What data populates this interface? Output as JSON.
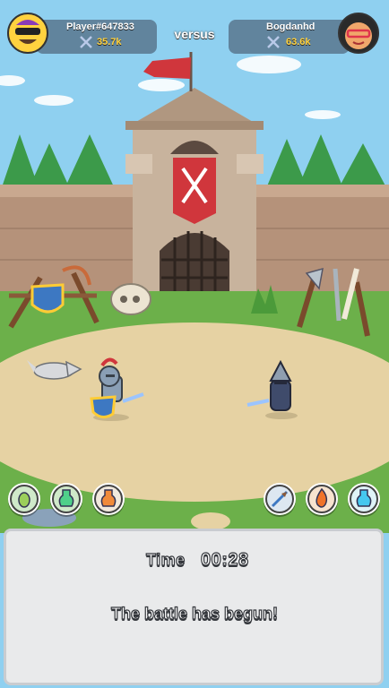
{
  "player_left": {
    "name": "Player#647833",
    "score": "35.7k",
    "avatar_icon": "sunglasses-face-avatar"
  },
  "player_right": {
    "name": "Bogdanhd",
    "score": "63.6k",
    "avatar_icon": "red-glasses-face-avatar"
  },
  "versus_label": "versus",
  "abilities_left": [
    "seed-ability-icon",
    "green-potion-icon",
    "orange-potion-icon"
  ],
  "abilities_right": [
    "arrow-ability-icon",
    "fire-ability-icon",
    "blue-potion-icon"
  ],
  "panel": {
    "time_label": "Time",
    "time_value": "00:28",
    "status": "The battle has begun!"
  },
  "colors": {
    "score": "#ffd23f",
    "panel_bg": "#e9eaeb",
    "sand": "#e6d2a3",
    "grass": "#6cb04a",
    "sky": "#8fd0f0"
  }
}
